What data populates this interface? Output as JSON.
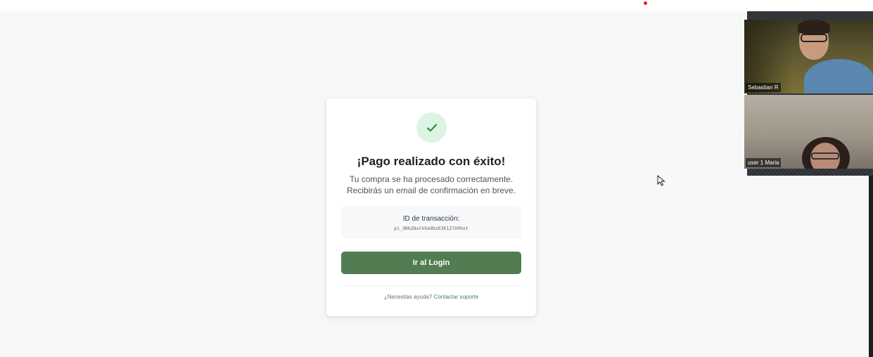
{
  "card": {
    "title": "¡Pago realizado con éxito!",
    "subtitle_line1": "Tu compra se ha procesado correctamente.",
    "subtitle_line2": "Recibirás un email de confirmación en breve.",
    "transaction_label": "ID de transacción:",
    "transaction_id": "pi_3RbZ8xCVXa9DzE3E1Z7X9hxt",
    "login_button_label": "Ir al Login",
    "help_text": "¿Necesitas ayuda?",
    "help_link": "Contactar soporte",
    "success_icon": "check-icon"
  },
  "video_call": {
    "participants": [
      {
        "name": "Sebastian R"
      },
      {
        "name": "user 1 Maria"
      }
    ]
  },
  "colors": {
    "primary_button": "#527d52",
    "success_circle": "#dcf4e4",
    "check_mark": "#2e8b45",
    "recording_dot": "#e0201b"
  }
}
